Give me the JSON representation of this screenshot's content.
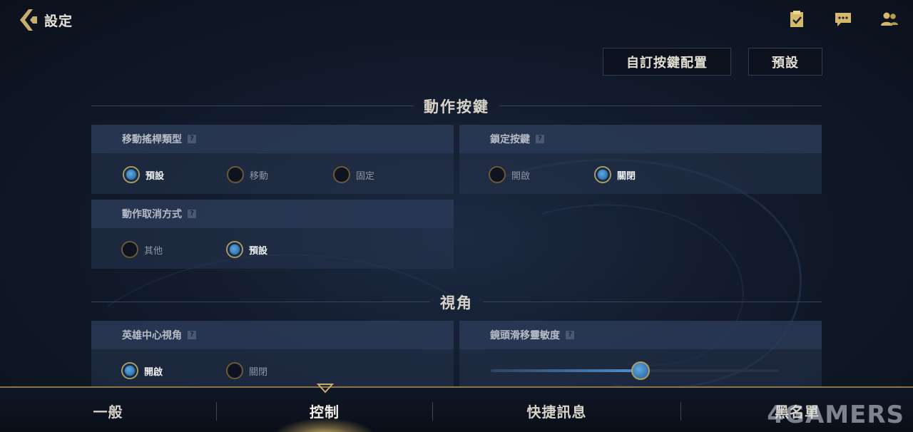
{
  "header": {
    "title": "設定",
    "icons": [
      "clipboard-check-icon",
      "chat-icon",
      "friends-icon"
    ]
  },
  "buttons": {
    "custom_layout": "自訂按鍵配置",
    "default": "預設"
  },
  "sections": {
    "action_buttons": "動作按鍵",
    "camera": "視角"
  },
  "panels": {
    "joystick": {
      "label": "移動搖桿類型",
      "options": [
        "預設",
        "移動",
        "固定"
      ],
      "selected": "預設"
    },
    "lock": {
      "label": "鎖定按鍵",
      "options": [
        "開啟",
        "關閉"
      ],
      "selected": "關閉"
    },
    "cancel": {
      "label": "動作取消方式",
      "options": [
        "其他",
        "預設"
      ],
      "selected": "預設"
    },
    "hero_center": {
      "label": "英雄中心視角",
      "options": [
        "開啟",
        "關閉"
      ],
      "selected": "開啟"
    },
    "camera_sensitivity": {
      "label": "鏡頭滑移靈敏度",
      "value_fraction": 0.52
    }
  },
  "help_glyph": "?",
  "nav": {
    "tabs": [
      "一般",
      "控制",
      "快捷訊息",
      "黑名單"
    ],
    "active": "控制"
  },
  "watermark": "4GAMERS",
  "colors": {
    "accent_gold": "#b59a5f",
    "radio_blue": "#3b8bd0"
  }
}
